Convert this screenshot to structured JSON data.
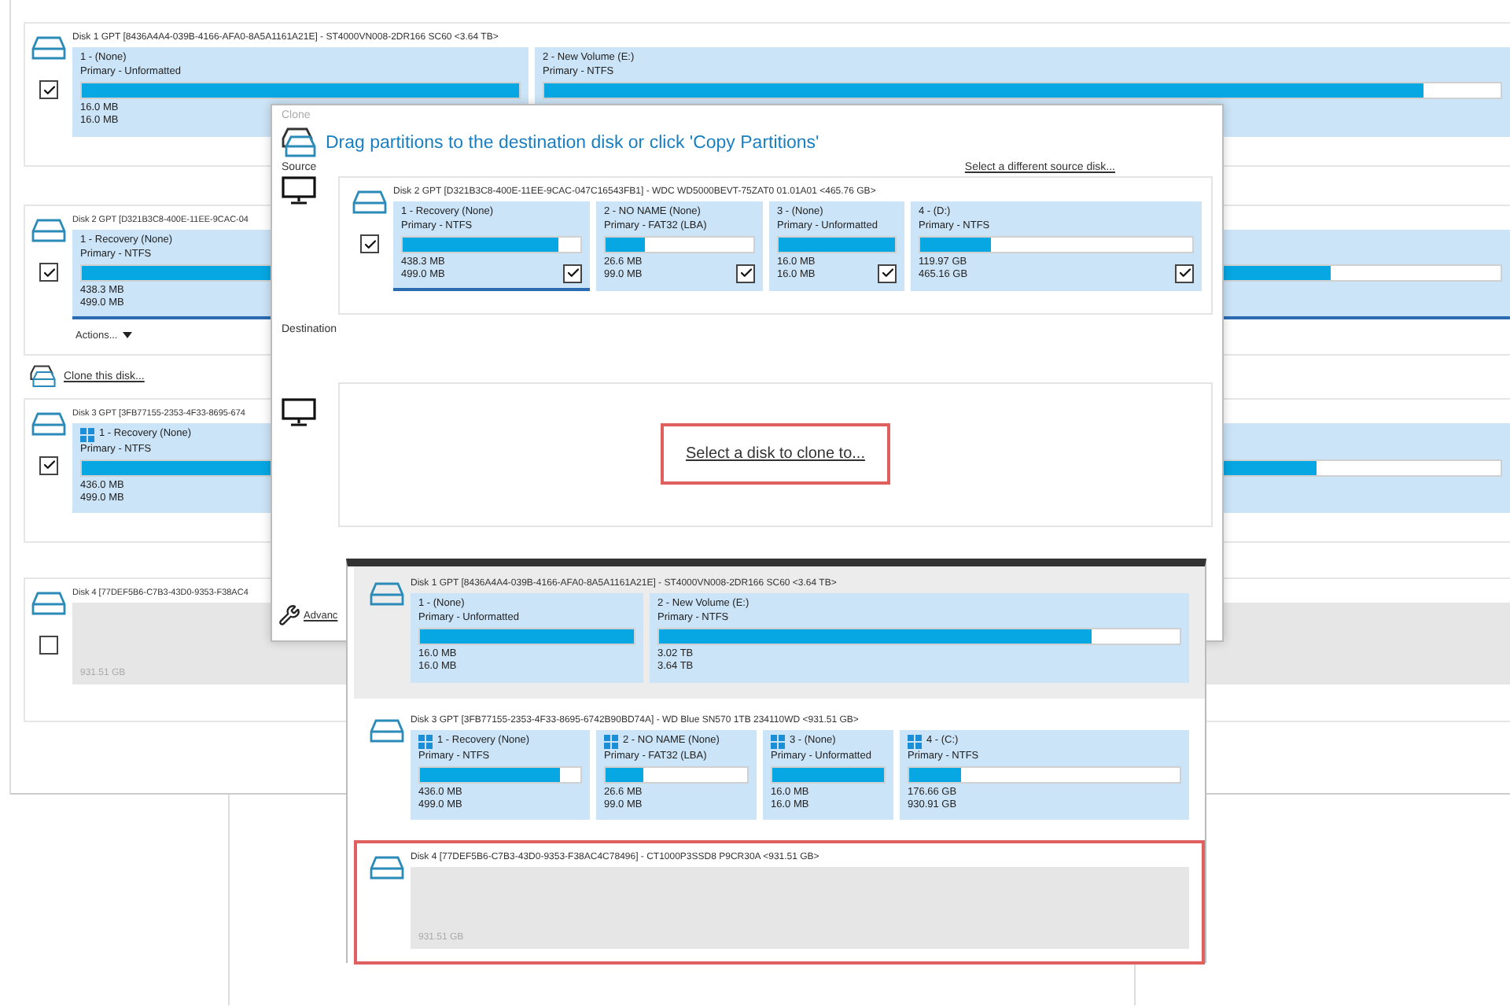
{
  "main": {
    "disks": [
      {
        "kind": "partitioned",
        "title": "Disk 1 GPT [8436A4A4-039B-4166-AFA0-8A5A1161A21E] - ST4000VN008-2DR166 SC60  <3.64 TB>",
        "checked": true,
        "partitions": [
          {
            "name": "1 -  (None)",
            "type": "Primary - Unformatted",
            "level": 1,
            "used": "16.0 MB",
            "total": "16.0 MB",
            "selected": false
          },
          {
            "name": "2 - New Volume (E:)",
            "type": "Primary - NTFS",
            "level": 0.92,
            "selected": false
          }
        ]
      },
      {
        "kind": "partitioned",
        "title": "Disk 2 GPT [D321B3C8-400E-11EE-9CAC-04",
        "checked": true,
        "actions": "Actions...",
        "partitions": [
          {
            "name": "1 - Recovery (None)",
            "type": "Primary - NTFS",
            "level": 0.88,
            "used": "438.3 MB",
            "total": "499.0 MB",
            "selected": true
          }
        ]
      },
      {
        "kind": "partitioned",
        "title": "Disk 3 GPT [3FB77155-2353-4F33-8695-674",
        "checked": true,
        "partitions": [
          {
            "name": "1 - Recovery (None)",
            "type": "Primary - NTFS",
            "level": 0.87,
            "used": "436.0 MB",
            "total": "499.0 MB",
            "selected": false,
            "windows_logo": true
          }
        ]
      },
      {
        "kind": "unallocated",
        "title": "Disk 4 [77DEF5B6-C7B3-43D0-9353-F38AC4",
        "checked": false,
        "size": "931.51 GB"
      }
    ],
    "clone_link": "Clone this disk..."
  },
  "clone_dialog": {
    "title": "Clone",
    "heading": "Drag partitions to the destination disk or click 'Copy Partitions'",
    "source_label": "Source",
    "source_link": "Select a different source disk...",
    "source_disk": {
      "title": "Disk 2 GPT [D321B3C8-400E-11EE-9CAC-047C16543FB1] - WDC WD5000BEVT-75ZAT0 01.01A01  <465.76 GB>",
      "checked": true,
      "partitions": [
        {
          "name": "1 - Recovery (None)",
          "type": "Primary - NTFS",
          "level": 0.88,
          "used": "438.3 MB",
          "total": "499.0 MB",
          "checked": true,
          "selected": true
        },
        {
          "name": "2 - NO NAME (None)",
          "type": "Primary - FAT32 (LBA)",
          "level": 0.27,
          "used": "26.6 MB",
          "total": "99.0 MB",
          "checked": true,
          "selected": false
        },
        {
          "name": "3 -  (None)",
          "type": "Primary - Unformatted",
          "level": 1,
          "used": "16.0 MB",
          "total": "16.0 MB",
          "checked": true,
          "selected": false
        },
        {
          "name": "4 -  (D:)",
          "type": "Primary - NTFS",
          "level": 0.26,
          "used": "119.97 GB",
          "total": "465.16 GB",
          "checked": true,
          "selected": false
        }
      ]
    },
    "destination_label": "Destination",
    "destination_button": {
      "label": "Select a disk to clone to...",
      "outlined": true
    },
    "advanced_link": "Advanc"
  },
  "disk_dropdown": {
    "items": [
      {
        "kind": "partitioned",
        "title": "Disk 1 GPT [8436A4A4-039B-4166-AFA0-8A5A1161A21E] - ST4000VN008-2DR166 SC60  <3.64 TB>",
        "highlighted": true,
        "outlined": false,
        "partitions": [
          {
            "name": "1 -  (None)",
            "type": "Primary - Unformatted",
            "level": 1,
            "used": "16.0 MB",
            "total": "16.0 MB"
          },
          {
            "name": "2 - New Volume (E:)",
            "type": "Primary - NTFS",
            "level": 0.83,
            "used": "3.02 TB",
            "total": "3.64 TB"
          }
        ]
      },
      {
        "kind": "partitioned",
        "title": "Disk 3 GPT [3FB77155-2353-4F33-8695-6742B90BD74A] - WD Blue SN570 1TB 234110WD  <931.51 GB>",
        "highlighted": false,
        "outlined": false,
        "partitions": [
          {
            "name": "1 - Recovery (None)",
            "type": "Primary - NTFS",
            "level": 0.87,
            "used": "436.0 MB",
            "total": "499.0 MB",
            "windows_logo": true
          },
          {
            "name": "2 - NO NAME (None)",
            "type": "Primary - FAT32 (LBA)",
            "level": 0.27,
            "used": "26.6 MB",
            "total": "99.0 MB",
            "windows_logo": true
          },
          {
            "name": "3 -  (None)",
            "type": "Primary - Unformatted",
            "level": 1,
            "used": "16.0 MB",
            "total": "16.0 MB",
            "windows_logo": true
          },
          {
            "name": "4 -  (C:)",
            "type": "Primary - NTFS",
            "level": 0.19,
            "used": "176.66 GB",
            "total": "930.91 GB",
            "windows_logo": true
          }
        ]
      },
      {
        "kind": "unallocated",
        "title": "Disk 4 [77DEF5B6-C7B3-43D0-9353-F38AC4C78496] - CT1000P3SSD8 P9CR30A  <931.51 GB>",
        "highlighted": false,
        "outlined": true,
        "size": "931.51 GB"
      }
    ]
  }
}
